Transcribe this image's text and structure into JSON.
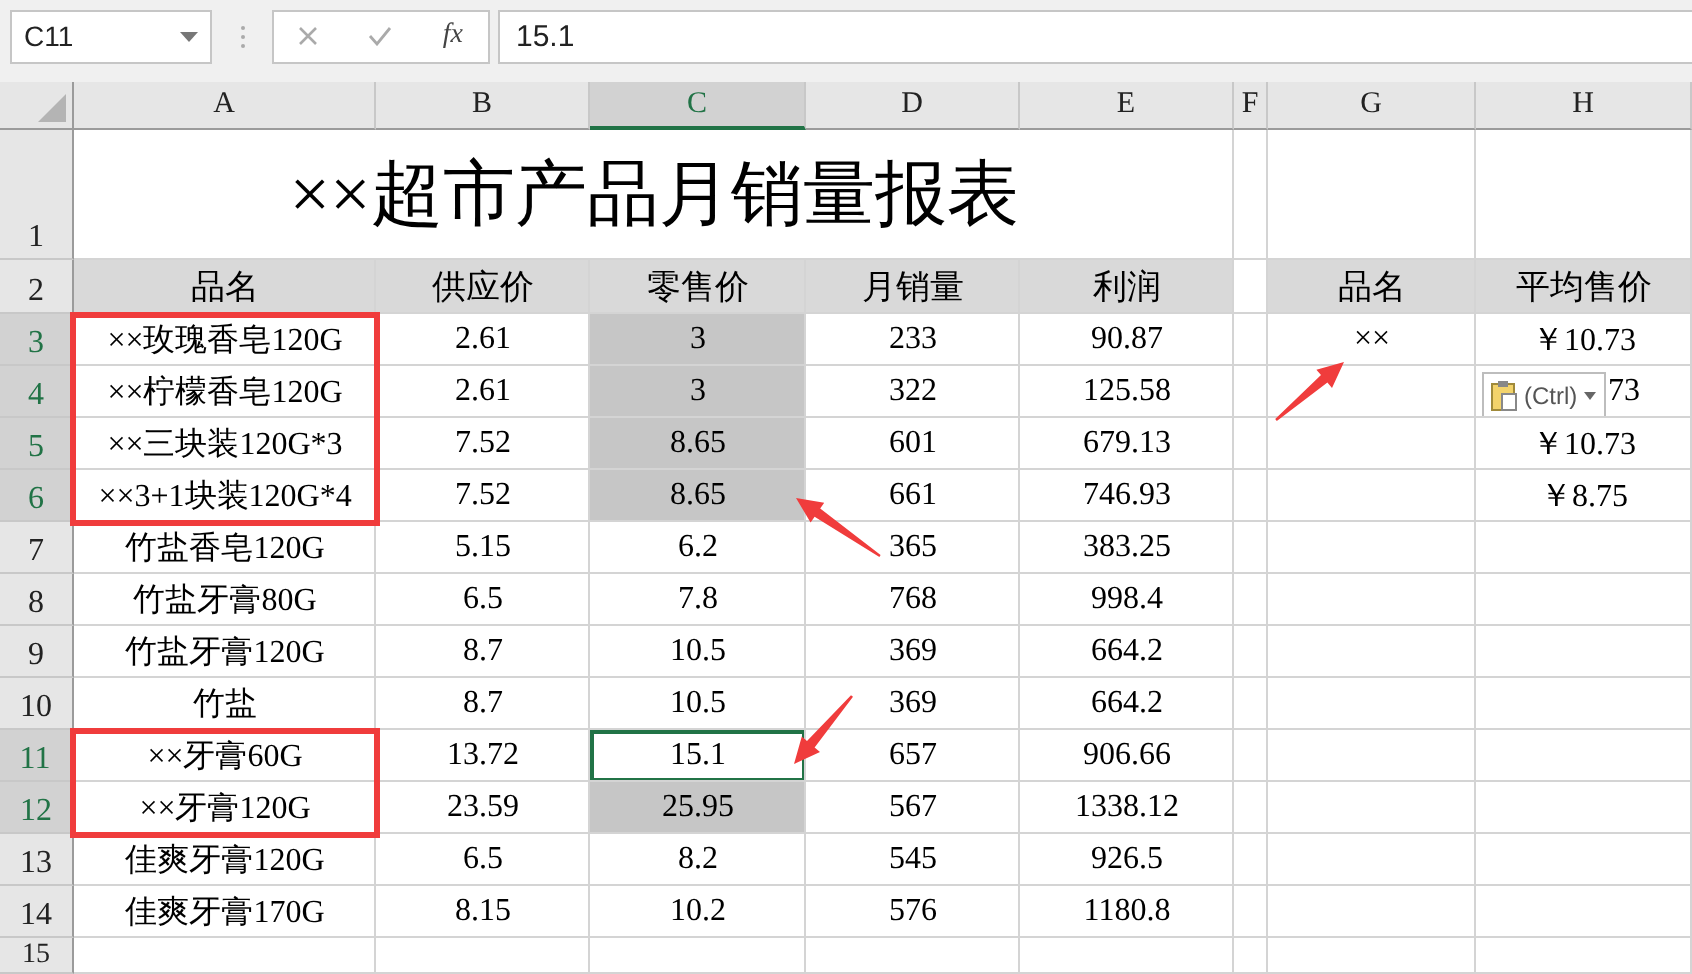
{
  "name_box": "C11",
  "fx_label": "fx",
  "formula": "15.1",
  "columns": [
    {
      "label": "A",
      "selected": false
    },
    {
      "label": "B",
      "selected": false
    },
    {
      "label": "C",
      "selected": true
    },
    {
      "label": "D",
      "selected": false
    },
    {
      "label": "E",
      "selected": false
    },
    {
      "label": "F",
      "selected": false
    },
    {
      "label": "G",
      "selected": false
    },
    {
      "label": "H",
      "selected": false
    }
  ],
  "rows": [
    {
      "number": "1",
      "kind": "title",
      "selected": false,
      "title": "××超市产品月销量报表"
    },
    {
      "number": "2",
      "kind": "header",
      "selected": false,
      "cells": [
        {
          "text": "品名",
          "selected": false,
          "active": false
        },
        {
          "text": "供应价",
          "selected": false,
          "active": false
        },
        {
          "text": "零售价",
          "selected": false,
          "active": false
        },
        {
          "text": "月销量",
          "selected": false,
          "active": false
        },
        {
          "text": "利润",
          "selected": false,
          "active": false
        },
        null,
        {
          "text": "品名",
          "selected": false,
          "active": false
        },
        {
          "text": "平均售价",
          "selected": false,
          "active": false
        }
      ]
    },
    {
      "number": "3",
      "kind": "data",
      "selected": true,
      "cells": [
        {
          "text": "××玫瑰香皂120G",
          "selected": false,
          "active": false,
          "annotation": {
            "kind": "box"
          }
        },
        {
          "text": "2.61",
          "selected": false,
          "active": false
        },
        {
          "text": "3",
          "selected": true,
          "active": false
        },
        {
          "text": "233",
          "selected": false,
          "active": false
        },
        {
          "text": "90.87",
          "selected": false,
          "active": false
        },
        null,
        {
          "text": "××",
          "selected": false,
          "active": false,
          "annotation": {
            "kind": "arrow-from-lower-left"
          }
        },
        {
          "text": "￥10.73",
          "selected": false,
          "active": false
        }
      ]
    },
    {
      "number": "4",
      "kind": "data",
      "selected": true,
      "cells": [
        {
          "text": "××柠檬香皂120G",
          "selected": false,
          "active": false,
          "annotation": {
            "kind": "box"
          }
        },
        {
          "text": "2.61",
          "selected": false,
          "active": false
        },
        {
          "text": "3",
          "selected": true,
          "active": false
        },
        {
          "text": "322",
          "selected": false,
          "active": false
        },
        {
          "text": "125.58",
          "selected": false,
          "active": false
        },
        null,
        null,
        {
          "text": "73",
          "selected": false,
          "active": false,
          "paste_options": "(Ctrl)"
        }
      ]
    },
    {
      "number": "5",
      "kind": "data",
      "selected": true,
      "cells": [
        {
          "text": "××三块装120G*3",
          "selected": false,
          "active": false,
          "annotation": {
            "kind": "box"
          }
        },
        {
          "text": "7.52",
          "selected": false,
          "active": false
        },
        {
          "text": "8.65",
          "selected": true,
          "active": false
        },
        {
          "text": "601",
          "selected": false,
          "active": false
        },
        {
          "text": "679.13",
          "selected": false,
          "active": false
        },
        null,
        null,
        {
          "text": "￥10.73",
          "selected": false,
          "active": false
        }
      ]
    },
    {
      "number": "6",
      "kind": "data",
      "selected": true,
      "cells": [
        {
          "text": "××3+1块装120G*4",
          "selected": false,
          "active": false,
          "annotation": {
            "kind": "box"
          }
        },
        {
          "text": "7.52",
          "selected": false,
          "active": false
        },
        {
          "text": "8.65",
          "selected": true,
          "active": false,
          "annotation": {
            "kind": "arrow-from-lower-right"
          }
        },
        {
          "text": "661",
          "selected": false,
          "active": false
        },
        {
          "text": "746.93",
          "selected": false,
          "active": false
        },
        null,
        null,
        {
          "text": "￥8.75",
          "selected": false,
          "active": false
        }
      ]
    },
    {
      "number": "7",
      "kind": "data",
      "selected": false,
      "cells": [
        {
          "text": "竹盐香皂120G",
          "selected": false,
          "active": false
        },
        {
          "text": "5.15",
          "selected": false,
          "active": false
        },
        {
          "text": "6.2",
          "selected": false,
          "active": false
        },
        {
          "text": "365",
          "selected": false,
          "active": false
        },
        {
          "text": "383.25",
          "selected": false,
          "active": false
        }
      ]
    },
    {
      "number": "8",
      "kind": "data",
      "selected": false,
      "cells": [
        {
          "text": "竹盐牙膏80G",
          "selected": false,
          "active": false
        },
        {
          "text": "6.5",
          "selected": false,
          "active": false
        },
        {
          "text": "7.8",
          "selected": false,
          "active": false
        },
        {
          "text": "768",
          "selected": false,
          "active": false
        },
        {
          "text": "998.4",
          "selected": false,
          "active": false
        }
      ]
    },
    {
      "number": "9",
      "kind": "data",
      "selected": false,
      "cells": [
        {
          "text": "竹盐牙膏120G",
          "selected": false,
          "active": false
        },
        {
          "text": "8.7",
          "selected": false,
          "active": false
        },
        {
          "text": "10.5",
          "selected": false,
          "active": false
        },
        {
          "text": "369",
          "selected": false,
          "active": false
        },
        {
          "text": "664.2",
          "selected": false,
          "active": false
        }
      ]
    },
    {
      "number": "10",
      "kind": "data",
      "selected": false,
      "cells": [
        {
          "text": "竹盐",
          "selected": false,
          "active": false
        },
        {
          "text": "8.7",
          "selected": false,
          "active": false
        },
        {
          "text": "10.5",
          "selected": false,
          "active": false
        },
        {
          "text": "369",
          "selected": false,
          "active": false
        },
        {
          "text": "664.2",
          "selected": false,
          "active": false
        }
      ]
    },
    {
      "number": "11",
      "kind": "data",
      "selected": true,
      "cells": [
        {
          "text": "××牙膏60G",
          "selected": false,
          "active": false,
          "annotation": {
            "kind": "box"
          }
        },
        {
          "text": "13.72",
          "selected": false,
          "active": false
        },
        {
          "text": "15.1",
          "selected": false,
          "active": true,
          "annotation": {
            "kind": "arrow-from-upper-right"
          }
        },
        {
          "text": "657",
          "selected": false,
          "active": false
        },
        {
          "text": "906.66",
          "selected": false,
          "active": false
        }
      ]
    },
    {
      "number": "12",
      "kind": "data",
      "selected": true,
      "cells": [
        {
          "text": "××牙膏120G",
          "selected": false,
          "active": false,
          "annotation": {
            "kind": "box"
          }
        },
        {
          "text": "23.59",
          "selected": false,
          "active": false
        },
        {
          "text": "25.95",
          "selected": true,
          "active": false
        },
        {
          "text": "567",
          "selected": false,
          "active": false
        },
        {
          "text": "1338.12",
          "selected": false,
          "active": false
        }
      ]
    },
    {
      "number": "13",
      "kind": "data",
      "selected": false,
      "cells": [
        {
          "text": "佳爽牙膏120G",
          "selected": false,
          "active": false
        },
        {
          "text": "6.5",
          "selected": false,
          "active": false
        },
        {
          "text": "8.2",
          "selected": false,
          "active": false
        },
        {
          "text": "545",
          "selected": false,
          "active": false
        },
        {
          "text": "926.5",
          "selected": false,
          "active": false
        }
      ]
    },
    {
      "number": "14",
      "kind": "data",
      "selected": false,
      "cells": [
        {
          "text": "佳爽牙膏170G",
          "selected": false,
          "active": false
        },
        {
          "text": "8.15",
          "selected": false,
          "active": false
        },
        {
          "text": "10.2",
          "selected": false,
          "active": false
        },
        {
          "text": "576",
          "selected": false,
          "active": false
        },
        {
          "text": "1180.8",
          "selected": false,
          "active": false
        }
      ]
    },
    {
      "number": "15",
      "kind": "data",
      "selected": false
    }
  ]
}
